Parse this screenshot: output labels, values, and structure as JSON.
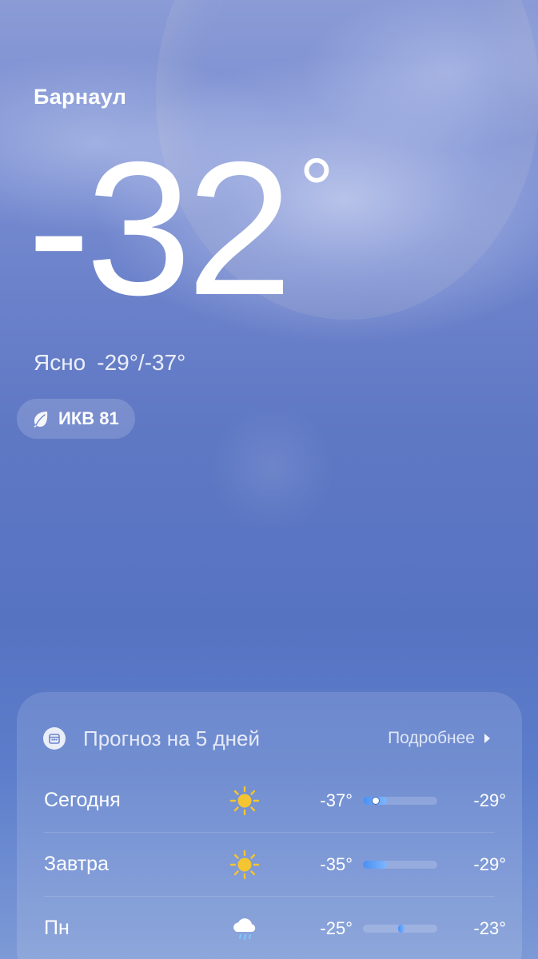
{
  "location": {
    "city": "Барнаул"
  },
  "current": {
    "temperature": "-32",
    "degree_symbol": "°",
    "condition": "Ясно",
    "range": "-29°/-37°"
  },
  "aqi": {
    "label": "ИКВ 81",
    "icon": "leaf-icon"
  },
  "forecast": {
    "title": "Прогноз на 5 дней",
    "more_label": "Подробнее",
    "icon": "calendar-icon",
    "days": [
      {
        "day": "Сегодня",
        "icon": "sun-icon",
        "low": "-37°",
        "high": "-29°",
        "bar_start": 0.0,
        "bar_end": 0.32,
        "current_marker": 0.17
      },
      {
        "day": "Завтра",
        "icon": "sun-icon",
        "low": "-35°",
        "high": "-29°",
        "bar_start": 0.0,
        "bar_end": 0.32
      },
      {
        "day": "Пн",
        "icon": "rain-cloud-icon",
        "low": "-25°",
        "high": "-23°",
        "bar_start": 0.47,
        "bar_end": 0.53
      }
    ]
  },
  "colors": {
    "bar_fill": "#4b8ff2",
    "sun": "#f5c531"
  }
}
